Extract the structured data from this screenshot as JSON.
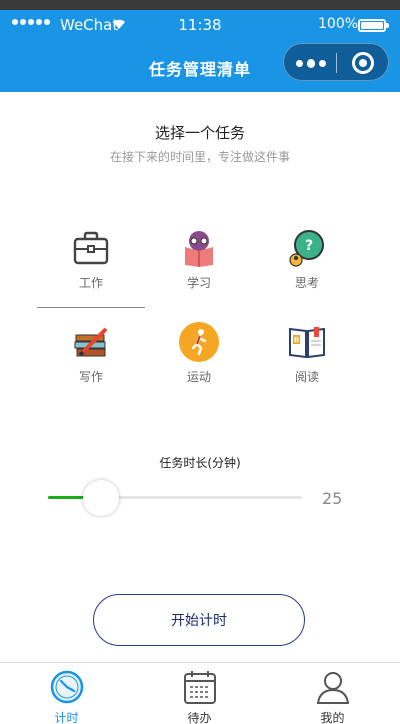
{
  "status_bar": {
    "carrier": "WeChat",
    "time": "11:38",
    "battery": "100%"
  },
  "nav": {
    "title": "任务管理清单"
  },
  "intro": {
    "title": "选择一个任务",
    "subtitle": "在接下来的时间里，专注做这件事"
  },
  "tasks": [
    {
      "label": "工作",
      "icon": "briefcase-icon",
      "selected": true
    },
    {
      "label": "学习",
      "icon": "study-icon",
      "selected": false
    },
    {
      "label": "思考",
      "icon": "thinking-icon",
      "selected": false
    },
    {
      "label": "写作",
      "icon": "writing-icon",
      "selected": false
    },
    {
      "label": "运动",
      "icon": "running-icon",
      "selected": false
    },
    {
      "label": "阅读",
      "icon": "reading-icon",
      "selected": false
    }
  ],
  "duration": {
    "label": "任务时长(分钟)",
    "value": "25",
    "fraction": 0.21
  },
  "start_button": {
    "label": "开始计时"
  },
  "tabbar": [
    {
      "label": "计时",
      "icon": "clock-icon",
      "active": true
    },
    {
      "label": "待办",
      "icon": "calendar-icon",
      "active": false
    },
    {
      "label": "我的",
      "icon": "user-icon",
      "active": false
    }
  ],
  "colors": {
    "primary": "#1a95e6",
    "slider_active": "#1aad19",
    "button_border": "#2a3a8c"
  }
}
